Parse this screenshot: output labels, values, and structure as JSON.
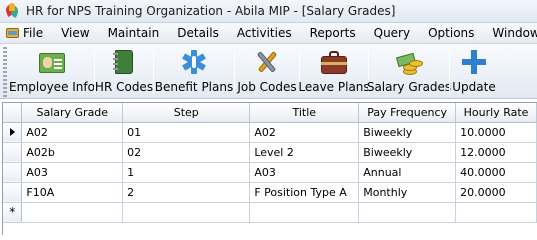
{
  "window": {
    "title": "HR for NPS Training Organization - Abila MIP - [Salary Grades]"
  },
  "menu": [
    "File",
    "View",
    "Maintain",
    "Details",
    "Activities",
    "Reports",
    "Query",
    "Options",
    "Windows"
  ],
  "toolbar": {
    "buttons": [
      {
        "label": "Employee Info",
        "icon": "employee-card-icon"
      },
      {
        "label": "HR Codes",
        "icon": "binder-icon"
      },
      {
        "label": "Benefit Plans",
        "icon": "medical-star-icon"
      },
      {
        "label": "Job Codes",
        "icon": "tools-icon"
      },
      {
        "label": "Leave Plans",
        "icon": "suitcase-icon"
      },
      {
        "label": "Salary Grades",
        "icon": "money-icon"
      },
      {
        "label": "Update",
        "icon": "update-icon"
      }
    ]
  },
  "grid": {
    "columns": [
      "Salary Grade",
      "Step",
      "Title",
      "Pay Frequency",
      "Hourly Rate"
    ],
    "rows": [
      {
        "grade": "A02",
        "step": "01",
        "title": "A02",
        "frequency": "Biweekly",
        "rate": "10.0000",
        "current": true
      },
      {
        "grade": "A02b",
        "step": "02",
        "title": "Level 2",
        "frequency": "Biweekly",
        "rate": "12.0000",
        "current": false
      },
      {
        "grade": "A03",
        "step": "1",
        "title": "A03",
        "frequency": "Annual",
        "rate": "40.0000",
        "current": false
      },
      {
        "grade": "F10A",
        "step": "2",
        "title": "F Position Type A",
        "frequency": "Monthly",
        "rate": "20.0000",
        "current": false
      }
    ],
    "new_row_marker": "*"
  }
}
